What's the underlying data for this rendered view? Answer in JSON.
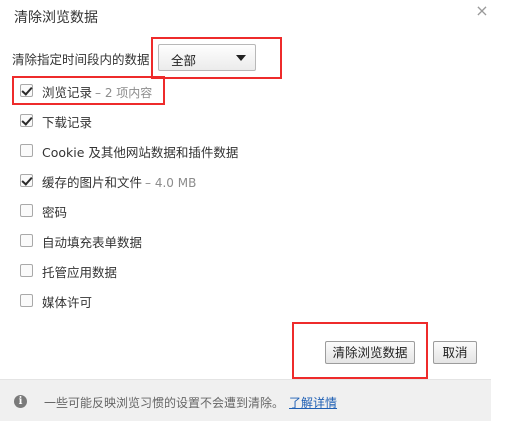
{
  "dialog": {
    "title": "清除浏览数据",
    "close_glyph": "×"
  },
  "time_range": {
    "label": "清除指定时间段内的数据",
    "selected": "全部"
  },
  "options": [
    {
      "label": "浏览记录",
      "meta": "– 2 项内容",
      "checked": true
    },
    {
      "label": "下载记录",
      "meta": "",
      "checked": true
    },
    {
      "label": "Cookie 及其他网站数据和插件数据",
      "meta": "",
      "checked": false
    },
    {
      "label": "缓存的图片和文件",
      "meta": "– 4.0 MB",
      "checked": true
    },
    {
      "label": "密码",
      "meta": "",
      "checked": false
    },
    {
      "label": "自动填充表单数据",
      "meta": "",
      "checked": false
    },
    {
      "label": "托管应用数据",
      "meta": "",
      "checked": false
    },
    {
      "label": "媒体许可",
      "meta": "",
      "checked": false
    }
  ],
  "buttons": {
    "clear_label": "清除浏览数据",
    "cancel_label": "取消"
  },
  "footer": {
    "info_glyph": "i",
    "text": "一些可能反映浏览习惯的设置不会遭到清除。",
    "link": "了解详情"
  },
  "colors": {
    "highlight": "#ee2b2b",
    "link": "#1e5fb4",
    "footer_bg": "#f0f0f0"
  }
}
